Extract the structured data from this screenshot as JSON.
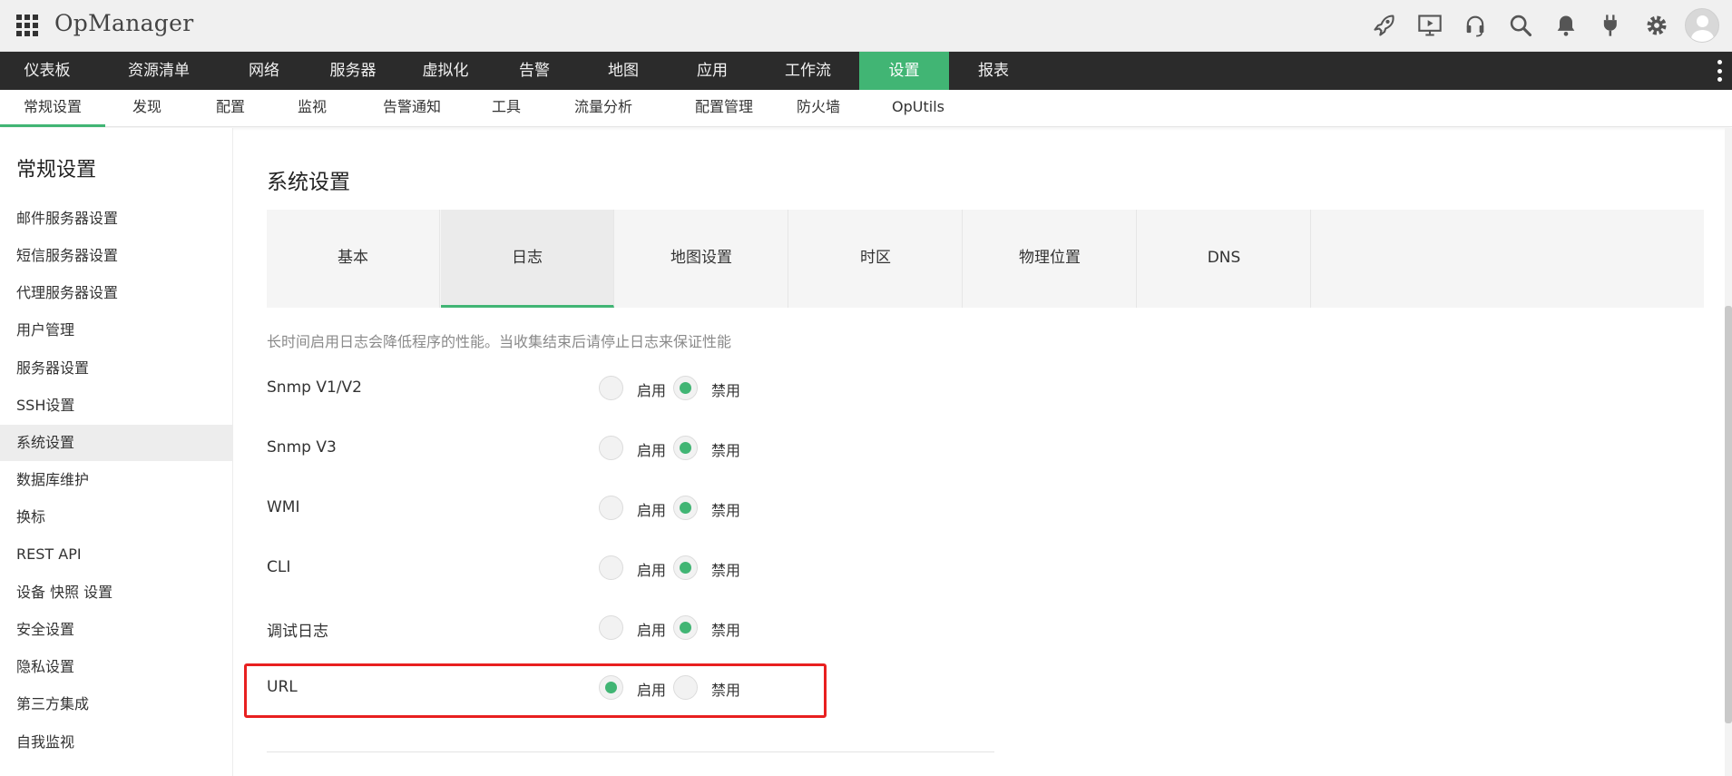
{
  "app": {
    "title": "OpManager"
  },
  "header_icons": [
    "rocket-icon",
    "presentation-icon",
    "headset-icon",
    "search-icon",
    "bell-icon",
    "plug-icon",
    "gear-icon",
    "user-avatar-icon"
  ],
  "main_nav": {
    "items": [
      "仪表板",
      "资源清单",
      "网络",
      "服务器",
      "虚拟化",
      "告警",
      "地图",
      "应用",
      "工作流",
      "设置",
      "报表"
    ],
    "active": "设置"
  },
  "sub_nav": {
    "items": [
      "常规设置",
      "发现",
      "配置",
      "监视",
      "告警通知",
      "工具",
      "流量分析",
      "配置管理",
      "防火墙",
      "OpUtils"
    ],
    "active": "常规设置"
  },
  "sidebar": {
    "title": "常规设置",
    "items": [
      "邮件服务器设置",
      "短信服务器设置",
      "代理服务器设置",
      "用户管理",
      "服务器设置",
      "SSH设置",
      "系统设置",
      "数据库维护",
      "换标",
      "REST API",
      "设备 快照 设置",
      "安全设置",
      "隐私设置",
      "第三方集成",
      "自我监视"
    ],
    "active": "系统设置"
  },
  "main": {
    "title": "系统设置",
    "tabs": [
      "基本",
      "日志",
      "地图设置",
      "时区",
      "物理位置",
      "DNS"
    ],
    "active_tab": "日志",
    "notice": "长时间启用日志会降低程序的性能。当收集结束后请停止日志来保证性能",
    "enable_label": "启用",
    "disable_label": "禁用",
    "log_settings": [
      {
        "name": "Snmp V1/V2",
        "value": "禁用"
      },
      {
        "name": "Snmp V3",
        "value": "禁用"
      },
      {
        "name": "WMI",
        "value": "禁用"
      },
      {
        "name": "CLI",
        "value": "禁用"
      },
      {
        "name": "调试日志",
        "value": "禁用"
      },
      {
        "name": "URL",
        "value": "启用"
      }
    ]
  },
  "colors": {
    "accent": "#41b574",
    "nav_bg": "#2b2b2b",
    "highlight": "#e82020"
  }
}
